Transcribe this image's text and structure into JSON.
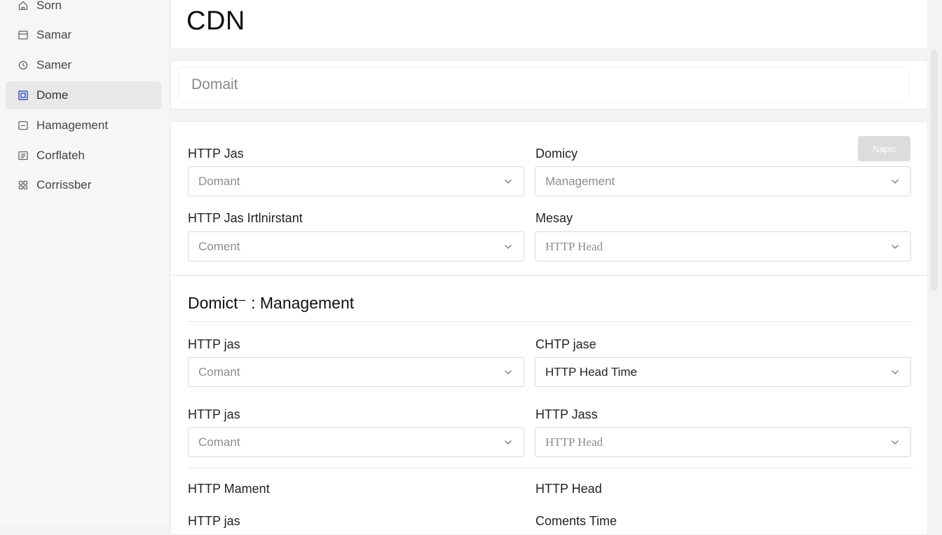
{
  "sidebar": {
    "items": [
      {
        "label": "Sorn",
        "icon": "home-icon"
      },
      {
        "label": "Samar",
        "icon": "table-icon"
      },
      {
        "label": "Samer",
        "icon": "clock-icon"
      },
      {
        "label": "Dome",
        "icon": "square-icon"
      },
      {
        "label": "Hamagement",
        "icon": "minus-box-icon"
      },
      {
        "label": "Corflateh",
        "icon": "list-box-icon"
      },
      {
        "label": "Corrissber",
        "icon": "grid-icon"
      }
    ],
    "active_index": 3
  },
  "header": {
    "title": "CDN"
  },
  "search": {
    "placeholder": "Domait"
  },
  "form": {
    "apply_label": "Napis",
    "row1": {
      "left_label": "HTTP Jas",
      "left_value": "Domant",
      "right_label": "Domicy",
      "right_value": "Management"
    },
    "row2": {
      "left_label": "HTTP Jas Irtlnirstant",
      "left_value": "Coment",
      "right_label": "Mesay",
      "right_value": "HTTP Head"
    },
    "section_title": "Domict⁻ : Management",
    "row3": {
      "left_label": "HTTP jas",
      "left_value": "Comant",
      "right_label": "CHTP jase",
      "right_value": "HTTP Head Time"
    },
    "row4": {
      "left_label": "HTTP jas",
      "left_value": "Comant",
      "right_label": "HTTP Jass",
      "right_value": "HTTP Head"
    },
    "row5": {
      "left_label": "HTTP Mament",
      "right_label": "HTTP Head"
    },
    "row6": {
      "left_label": "HTTP jas",
      "right_label": "Coments Time"
    }
  },
  "colors": {
    "accent": "#3b57b8",
    "apply_button_bg": "#dcdcdf"
  }
}
